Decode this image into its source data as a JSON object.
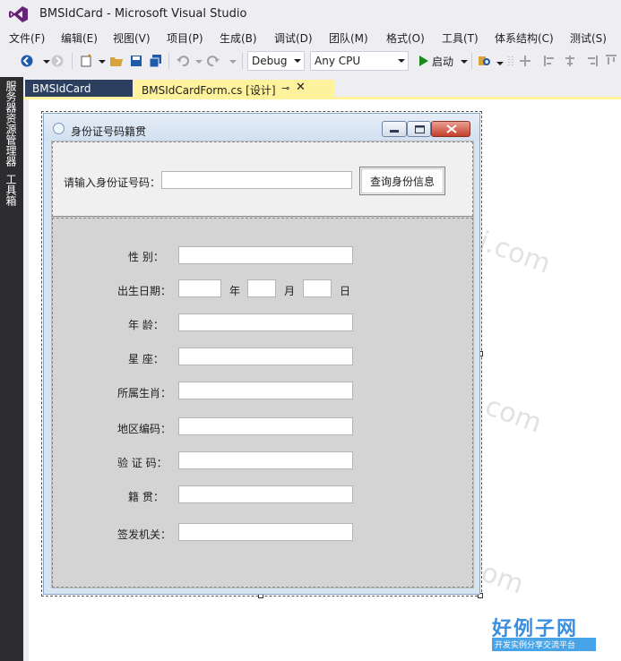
{
  "window": {
    "title": "BMSIdCard - Microsoft Visual Studio"
  },
  "menu": [
    "文件(F)",
    "编辑(E)",
    "视图(V)",
    "项目(P)",
    "生成(B)",
    "调试(D)",
    "团队(M)",
    "格式(O)",
    "工具(T)",
    "体系结构(C)",
    "测试(S)"
  ],
  "toolbar": {
    "config": "Debug",
    "platform": "Any CPU",
    "start_label": "启动"
  },
  "side_panel": [
    "服务器资源管理器",
    "工具箱"
  ],
  "tabs": [
    {
      "label": "BMSIdCard"
    },
    {
      "label": "BMSIdCardForm.cs [设计]"
    }
  ],
  "form": {
    "title": "身份证号码籍贯",
    "id_prompt": "请输入身份证号码：",
    "query_button": "查询身份信息",
    "fields": {
      "gender": "性    别：",
      "birth": "出生日期：",
      "year_unit": "年",
      "month_unit": "月",
      "day_unit": "日",
      "age": "年    龄：",
      "constellation": "星    座：",
      "zodiac": "所属生肖：",
      "region_code": "地区编码：",
      "check_code": "验 证 码：",
      "native_place": "籍    贯：",
      "issuer": "签发机关："
    }
  },
  "watermark": "www.haolizi.com",
  "logo": {
    "main": "好例子网",
    "sub": "开发实例分享交流平台"
  },
  "colors": {
    "accent": "#68217a",
    "tab_active": "#fff29d",
    "tab_inactive": "#2d3f5f",
    "side_panel": "#2d2d30"
  }
}
